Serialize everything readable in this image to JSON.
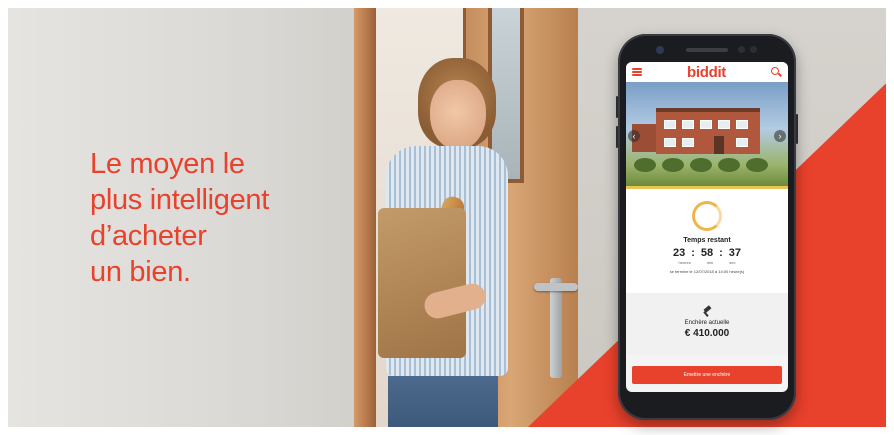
{
  "banner": {
    "headline_lines": [
      "Le moyen le",
      "plus intelligent",
      "d’acheter",
      "un bien."
    ],
    "colors": {
      "accent": "#e8412c",
      "wall": "#dcdad6",
      "door": "#c58d5e"
    }
  },
  "phone": {
    "app": {
      "logo": "biddit",
      "menu_icon": "hamburger-icon",
      "search_icon": "search-icon"
    },
    "listing": {
      "prev_arrow": "‹",
      "next_arrow": "›",
      "timer": {
        "label": "Temps restant",
        "hours": "23",
        "minutes": "58",
        "seconds": "37",
        "separator": ":",
        "unit_hours": "heures",
        "unit_minutes": "min",
        "unit_seconds": "sec",
        "ends_text": "se termine le 12/07/2018 à 14:00 heure(s)"
      },
      "bid": {
        "label": "Enchère actuelle",
        "value": "€ 410.000"
      },
      "cta_label": "Emettre une enchère"
    }
  }
}
